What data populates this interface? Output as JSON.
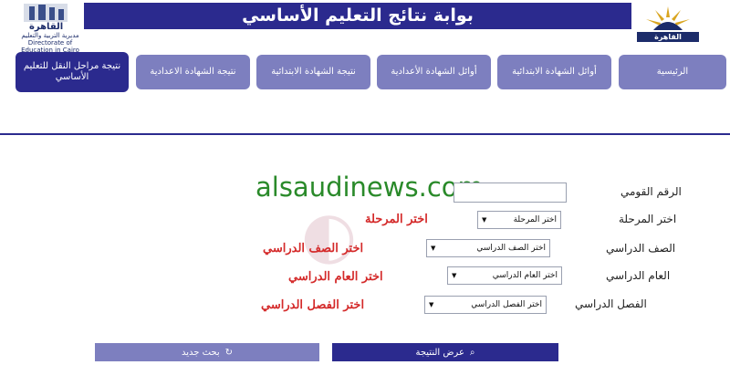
{
  "header": {
    "title": "بوابة نتائج التعليم الأساسي",
    "left_logo_title": "القاهرة",
    "left_logo_subtitle": "مديرية التربية والتعليم",
    "left_logo_caption": "Directorate of Education in Cairo",
    "right_logo_label": "القاهرة"
  },
  "nav": {
    "tabs": [
      {
        "label": "الرئيسية"
      },
      {
        "label": "أوائل الشهادة الابتدائية"
      },
      {
        "label": "أوائل الشهادة الأعدادية"
      },
      {
        "label": "نتيجة الشهادة الابتدائية"
      },
      {
        "label": "نتيجة الشهادة الاعدادية"
      },
      {
        "label": "نتيجة مراحل النقل للتعليم الأساسي"
      }
    ]
  },
  "watermark": "alsaudinews.com",
  "form": {
    "national_id": {
      "label": "الرقم القومي",
      "value": ""
    },
    "stage": {
      "label": "اختر المرحلة",
      "selected": "اختر المرحلة",
      "hint": "اختر المرحلة"
    },
    "grade": {
      "label": "الصف الدراسي",
      "selected": "اختر الصف الدراسي",
      "hint": "اختر الصف الدراسي"
    },
    "year": {
      "label": "العام الدراسي",
      "selected": "اختر العام الدراسي",
      "hint": "اختر العام الدراسي"
    },
    "term": {
      "label": "الفصل الدراسي",
      "selected": "اختر الفصل الدراسي",
      "hint": "اختر الفصل الدراسي"
    }
  },
  "buttons": {
    "new_search": "بحث جديد",
    "show_result": "عرض النتيجة"
  },
  "colors": {
    "primary": "#2b2a8e",
    "secondary": "#7d7fbf",
    "hint": "#d42a2a",
    "watermark": "#2a8a2a"
  }
}
